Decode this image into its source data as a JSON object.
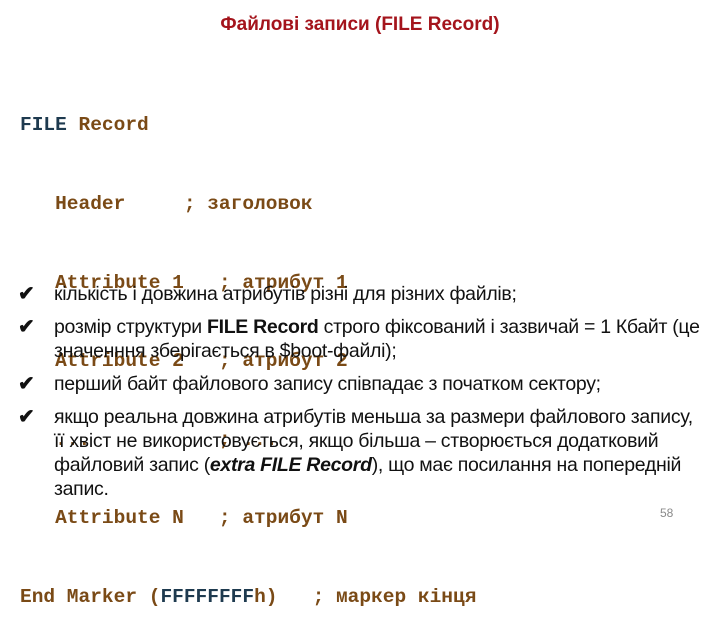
{
  "slide": {
    "title": "Файлові записи (FILE Record)",
    "page_number": "58"
  },
  "code": {
    "line1_kw": "FILE",
    "line1_rest": " Record",
    "lines": [
      "   Header     ; заголовок",
      "   Attribute 1   ; атрибут 1",
      "   Attribute 2   ; атрибут 2",
      "   ...           ; ...",
      "   Attribute N   ; атрибут N"
    ],
    "end_prefix": "End Marker (",
    "end_hex": "FFFFFFFF",
    "end_suffix": "h)   ; маркер кінця"
  },
  "bullets": [
    {
      "icon": "checkmark-icon",
      "text": "кількість і довжина атрибутів різні для різних файлів;"
    },
    {
      "icon": "checkmark-icon",
      "pre": "розмір структури ",
      "bold": "FILE Record",
      "post": " строго фіксований і зазвичай = 1 Кбайт (це значенння зберігається в $boot-файлі);"
    },
    {
      "icon": "checkmark-icon",
      "text": "перший байт файлового запису співпадає з початком сектору;"
    },
    {
      "icon": "checkmark-icon",
      "pre": "якщо реальна довжина атрибутів меньша за размери файлового запису, її хвіст не використовується, якщо більша – створюється додатковий файловий запис (",
      "bolditalic": "extra FILE Record",
      "post": "), що має посилання на попередній запис."
    }
  ]
}
